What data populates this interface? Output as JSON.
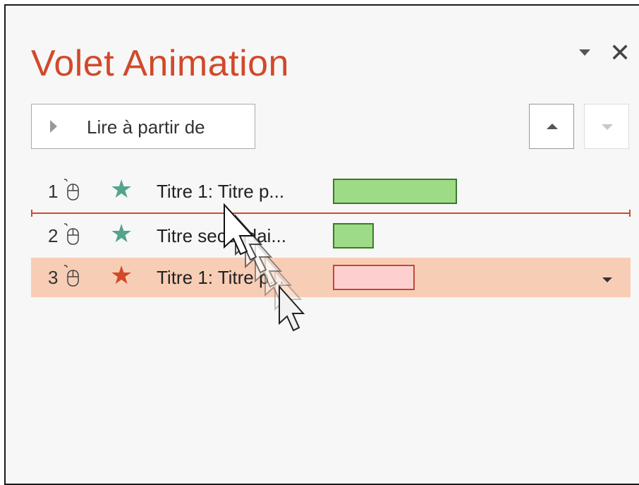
{
  "pane": {
    "title": "Volet Animation"
  },
  "toolbar": {
    "play_label": "Lire à partir de"
  },
  "icons": {
    "pane_menu": "chevron-down-icon",
    "close": "close-icon",
    "play": "play-icon",
    "move_up": "arrow-up-icon",
    "move_down": "arrow-down-icon",
    "mouse": "mouse-icon",
    "star": "star-icon",
    "cursor": "mouse-pointer-icon"
  },
  "animations": [
    {
      "num": "1",
      "label": "Titre 1: Titre p...",
      "color": "#53a48c",
      "bar_fill": "#9edb87",
      "bar_border": "#3c7a2b"
    },
    {
      "num": "2",
      "label": "Titre secondai...",
      "color": "#53a48c",
      "bar_fill": "#9edb87",
      "bar_border": "#3c7a2b"
    },
    {
      "num": "3",
      "label": "Titre 1: Titre p...",
      "color": "#d2492a",
      "bar_fill": "#fdd0cf",
      "bar_border": "#c2483a",
      "selected": true
    }
  ],
  "colors": {
    "accent": "#d2492a",
    "selected_row": "#f8cdb5",
    "entrance_star": "#53a48c"
  }
}
